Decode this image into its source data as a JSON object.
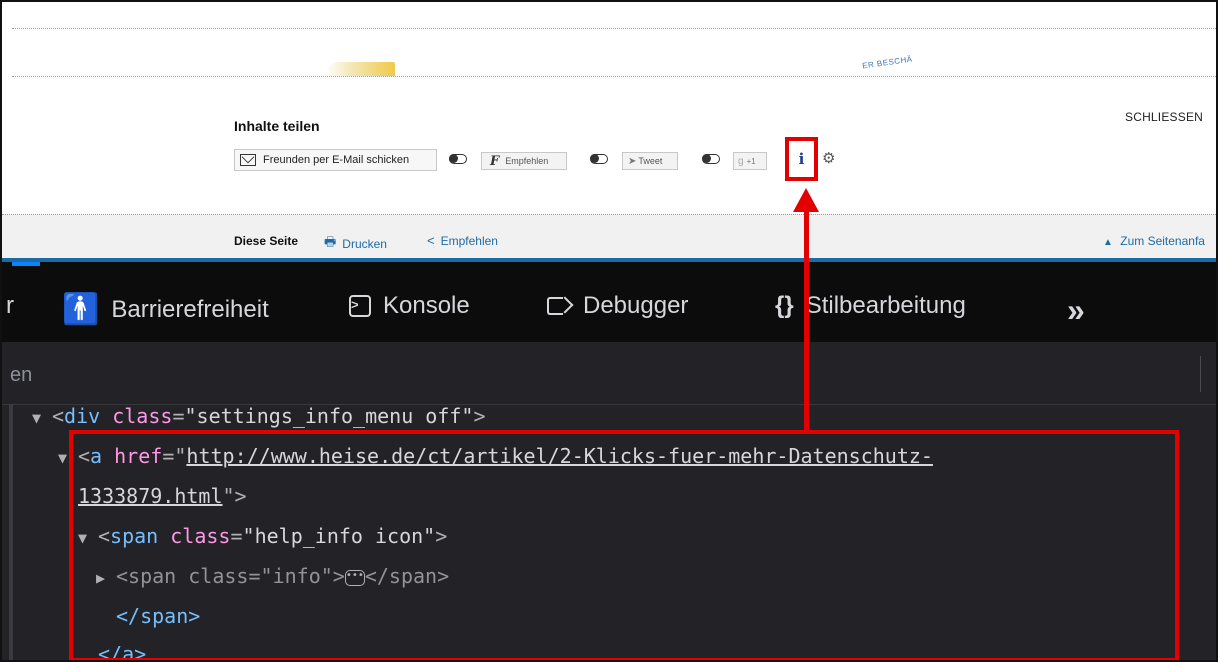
{
  "page": {
    "close_label": "SCHLIESSEN",
    "banner_text": "ER BESCHÄ",
    "share": {
      "title": "Inhalte teilen",
      "mail_button": "Freunden per E-Mail schicken",
      "facebook_button": "Empfehlen",
      "facebook_letter": "F",
      "twitter_button": "Tweet",
      "google_button": "+1",
      "info_icon": "i",
      "gear_icon": "gear-icon"
    },
    "footer": {
      "label": "Diese Seite",
      "print": "Drucken",
      "recommend": "Empfehlen",
      "to_top": "Zum Seitenanfa"
    }
  },
  "devtools": {
    "tabs": [
      {
        "label": "r"
      },
      {
        "label": "Barrierefreiheit",
        "icon": "accessibility-icon"
      },
      {
        "label": "Konsole",
        "icon": "console-icon"
      },
      {
        "label": "Debugger",
        "icon": "debugger-icon"
      },
      {
        "label": "Stilbearbeitung",
        "icon": "style-editor-icon"
      }
    ],
    "more_label": "»",
    "search_placeholder": "en",
    "tree": {
      "div_tag": "div",
      "div_attr": "class",
      "div_value": "\"settings_info_menu off\"",
      "a_tag": "a",
      "a_attr": "href",
      "a_url_1": "http://www.heise.de/ct/artikel/2-Klicks-fuer-mehr-Datenschutz-",
      "a_url_2": "1333879.html",
      "span_tag": "span",
      "span_attr": "class",
      "span_value": "\"help_info icon\"",
      "inner_span_tag": "span",
      "inner_span_attr": "class",
      "inner_span_value": "\"info\"",
      "close_span": "</span>",
      "close_a": "</a>"
    }
  },
  "colors": {
    "highlight": "#e20000",
    "link": "#1f6aa5",
    "devtools_bg": "#232327"
  }
}
